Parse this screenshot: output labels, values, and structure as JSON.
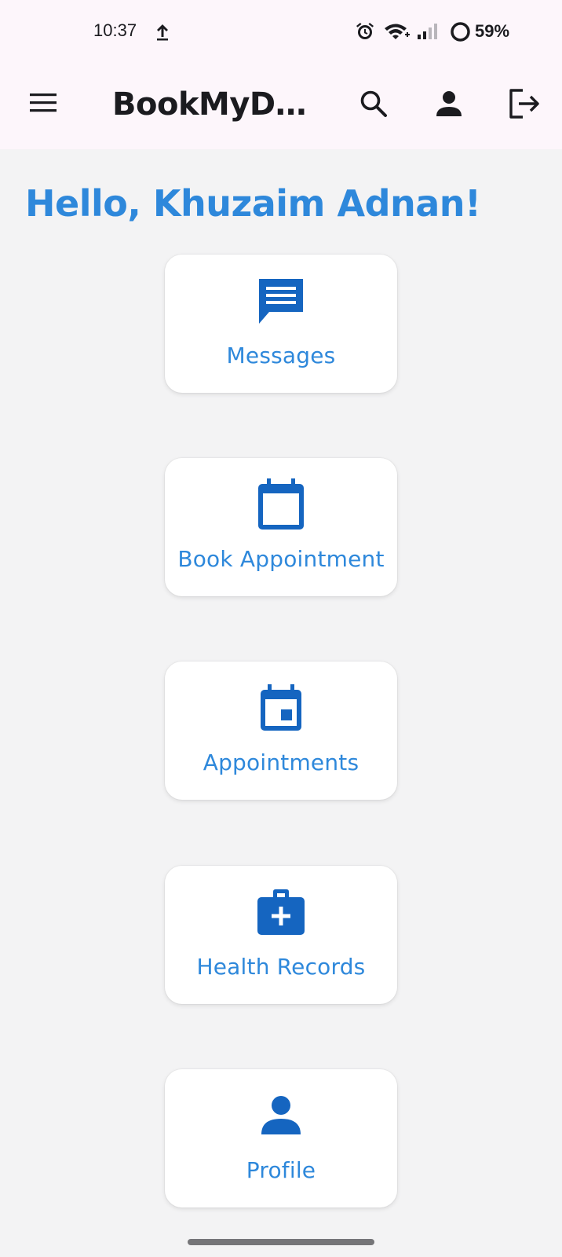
{
  "status_bar": {
    "time": "10:37",
    "battery_percent": "59%",
    "icons": [
      "upload-icon",
      "alarm-icon",
      "wifi-icon",
      "signal-icon",
      "battery-icon"
    ]
  },
  "app_bar": {
    "title": "BookMyD…",
    "actions": [
      "menu-icon",
      "search-icon",
      "person-icon",
      "logout-icon"
    ]
  },
  "greeting": "Hello, Khuzaim Adnan!",
  "cards": [
    {
      "label": "Messages",
      "icon": "message-icon"
    },
    {
      "label": "Book Appointment",
      "icon": "calendar-icon"
    },
    {
      "label": "Appointments",
      "icon": "event-icon"
    },
    {
      "label": "Health Records",
      "icon": "medical-bag-icon"
    },
    {
      "label": "Profile",
      "icon": "person-icon"
    }
  ],
  "colors": {
    "accent": "#2e88db",
    "icon": "#1565c0",
    "app_bar_bg": "#fdf6fb",
    "page_bg": "#f3f3f4"
  }
}
